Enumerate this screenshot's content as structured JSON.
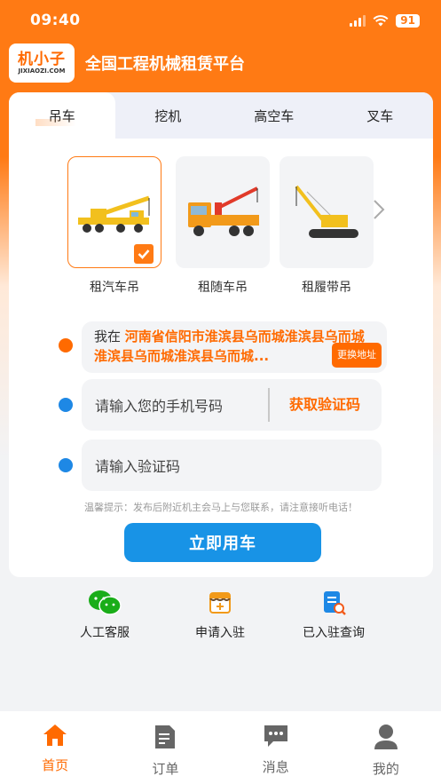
{
  "status_bar": {
    "time": "09:40",
    "battery": "91"
  },
  "header": {
    "logo_cn": "机小子",
    "logo_en": "JIXIAOZI.COM",
    "title": "全国工程机械租赁平台"
  },
  "tabs": [
    {
      "label": "吊车",
      "active": true
    },
    {
      "label": "挖机",
      "active": false
    },
    {
      "label": "高空车",
      "active": false
    },
    {
      "label": "叉车",
      "active": false
    }
  ],
  "machine_types": [
    {
      "label": "租汽车吊",
      "icon": "truck-crane-icon",
      "selected": true
    },
    {
      "label": "租随车吊",
      "icon": "truck-mounted-crane-icon",
      "selected": false
    },
    {
      "label": "租履带吊",
      "icon": "crawler-crane-icon",
      "selected": false
    }
  ],
  "form": {
    "address_prefix": "我在",
    "address": "河南省信阳市淮滨县乌而城淮滨县乌而城淮滨县乌而城淮滨县乌而城...",
    "change_address": "更换地址",
    "phone_placeholder": "请输入您的手机号码",
    "get_code": "获取验证码",
    "code_placeholder": "请输入验证码",
    "tip": "温馨提示：发布后附近机主会马上与您联系，请注意接听电话！",
    "submit": "立即用车"
  },
  "shortcuts": [
    {
      "label": "人工客服",
      "icon": "wechat-icon"
    },
    {
      "label": "申请入驻",
      "icon": "shop-icon"
    },
    {
      "label": "已入驻查询",
      "icon": "query-icon"
    }
  ],
  "tabbar": [
    {
      "label": "首页",
      "icon": "home-icon",
      "active": true
    },
    {
      "label": "订单",
      "icon": "order-icon",
      "active": false
    },
    {
      "label": "消息",
      "icon": "message-icon",
      "active": false
    },
    {
      "label": "我的",
      "icon": "profile-icon",
      "active": false
    }
  ],
  "colors": {
    "accent": "#ff6a00",
    "primary_blue": "#1893e6"
  }
}
